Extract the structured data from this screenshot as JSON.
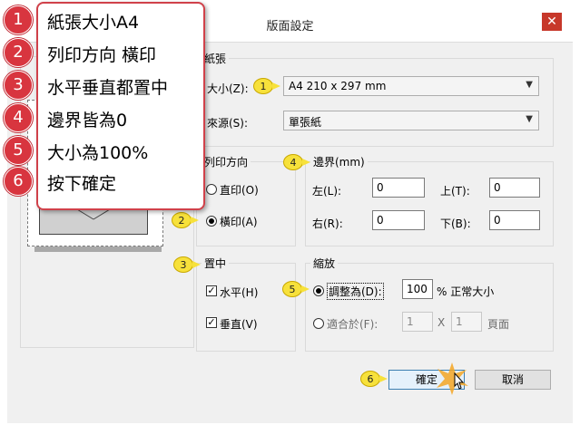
{
  "dialog": {
    "title": "版面設定",
    "close_symbol": "✕"
  },
  "paper": {
    "group_label": "紙張",
    "size_label": "大小(Z):",
    "size_value": "A4 210 x 297 mm",
    "source_label": "來源(S):",
    "source_value": "單張紙"
  },
  "orientation": {
    "group_label": "列印方向",
    "portrait_label": "直印(O)",
    "landscape_label": "橫印(A)",
    "selected": "landscape"
  },
  "margins": {
    "group_label": "邊界(mm)",
    "left_label": "左(L):",
    "left_value": "0",
    "top_label": "上(T):",
    "top_value": "0",
    "right_label": "右(R):",
    "right_value": "0",
    "bottom_label": "下(B):",
    "bottom_value": "0"
  },
  "center": {
    "group_label": "置中",
    "horizontal_label": "水平(H)",
    "horizontal_checked": true,
    "vertical_label": "垂直(V)",
    "vertical_checked": true
  },
  "scaling": {
    "group_label": "縮放",
    "adjust_label": "調整為(D):",
    "adjust_value": "100",
    "adjust_suffix": "% 正常大小",
    "fit_label": "適合於(F):",
    "fit_wide": "1",
    "fit_x": "X",
    "fit_tall": "1",
    "fit_suffix": "頁面",
    "selected": "adjust"
  },
  "buttons": {
    "ok": "確定",
    "cancel": "取消"
  },
  "markers": [
    "1",
    "2",
    "3",
    "4",
    "5",
    "6"
  ],
  "steps": [
    {
      "num": "1",
      "text": "紙張大小A4"
    },
    {
      "num": "2",
      "text": "列印方向 橫印"
    },
    {
      "num": "3",
      "text": "水平垂直都置中"
    },
    {
      "num": "4",
      "text": "邊界皆為0"
    },
    {
      "num": "5",
      "text": "大小為100%"
    },
    {
      "num": "6",
      "text": "按下確定"
    }
  ],
  "colors": {
    "step_badge": "#d8353f",
    "marker": "#f7e13b",
    "close_button": "#c7382a"
  }
}
